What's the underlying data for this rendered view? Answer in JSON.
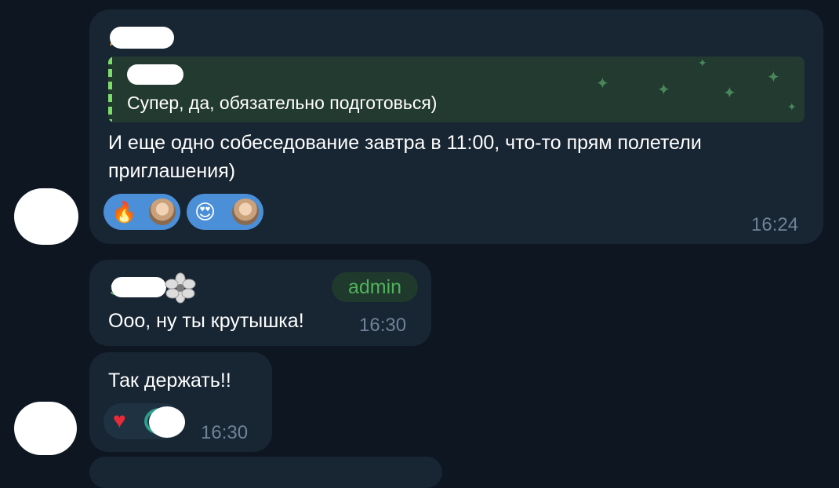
{
  "messages": [
    {
      "reply_quote": "Супер, да, обязательно подготовься)",
      "text_line1": "И еще одно собеседование завтра в 11:00, что-то прям полетели",
      "text_line2": "приглашения)",
      "time": "16:24",
      "reactions": [
        {
          "emoji": "🔥"
        },
        {
          "emoji": "😍"
        }
      ]
    },
    {
      "badge": "admin",
      "text": "Ооо, ну ты крутышка!",
      "time": "16:30"
    },
    {
      "text": "Так держать!!",
      "time": "16:30",
      "reactions": [
        {
          "emoji": "♥"
        }
      ]
    }
  ],
  "colors": {
    "background": "#0e1621",
    "bubble": "#182533",
    "reaction_selected": "#4a8fd8",
    "admin_badge_text": "#4fb25a",
    "sender_orange": "#f39c4b"
  }
}
